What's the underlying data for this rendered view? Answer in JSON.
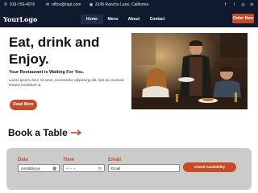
{
  "topbar": {
    "phone": "916-756-4076",
    "email": "office@rapt.com",
    "address": "3145 Rancho Lane, California"
  },
  "nav": {
    "logo": "YourLogo",
    "items": [
      "Home",
      "Menu",
      "About",
      "Contact"
    ],
    "active": "Home",
    "order_label": "Order Now"
  },
  "hero": {
    "title": "Eat, drink and Enjoy.",
    "subtitle": "Your Restaurant is Waiting For You.",
    "description": "Lorem ipsum dolor sit amet, consectetur adipiscing elit, sed do eiusmod tempor incididunt ut.",
    "button": "Read More"
  },
  "booking": {
    "title": "Book a Table",
    "date_label": "Date",
    "date_placeholder": "mm/dd/yyyy",
    "time_label": "Time",
    "time_placeholder": "--:-- --",
    "email_label": "Email",
    "email_placeholder": "Email",
    "button": "Check Availability"
  },
  "colors": {
    "navy": "#0f1a2e",
    "accent": "#c64a25",
    "panel": "#cbcbcb"
  }
}
